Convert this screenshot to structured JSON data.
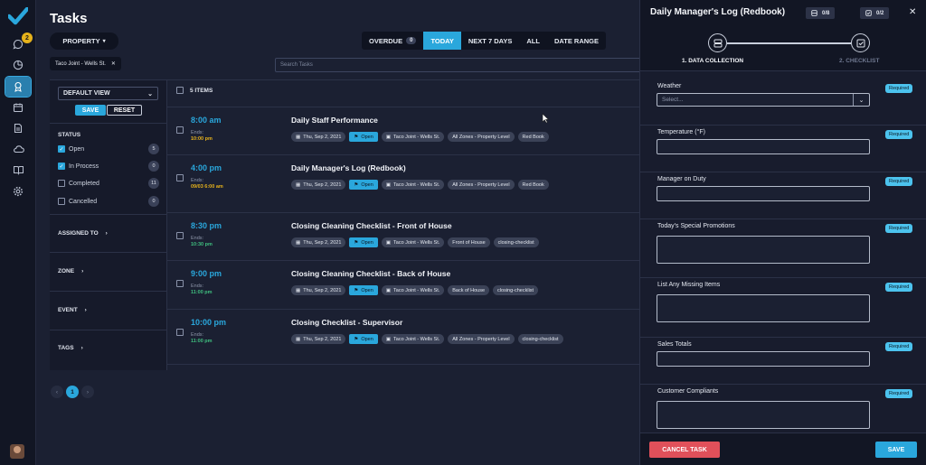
{
  "colors": {
    "accent": "#2aa7dc",
    "bg": "#1b2032",
    "danger": "#e0505a",
    "warning": "#e6b21b",
    "ends_green": "#3fbf7f"
  },
  "rail": {
    "badge": "2",
    "icons": [
      "check-logo-icon",
      "chat-icon",
      "clock-icon",
      "ribbon-icon",
      "calendar-icon",
      "document-icon",
      "cloud-icon",
      "book-icon",
      "gear-icon"
    ]
  },
  "header": {
    "title": "Tasks",
    "property_label": "PROPERTY",
    "filter_chip": "Taco Joint - Wells St.",
    "search_placeholder": "Search Tasks",
    "segments": [
      {
        "label": "OVERDUE",
        "count": "0",
        "active": false
      },
      {
        "label": "TODAY",
        "active": true
      },
      {
        "label": "NEXT 7 DAYS",
        "active": false
      },
      {
        "label": "ALL",
        "active": false
      },
      {
        "label": "DATE RANGE",
        "active": false
      }
    ]
  },
  "filters": {
    "view": "DEFAULT VIEW",
    "save": "SAVE",
    "reset": "RESET",
    "status_title": "STATUS",
    "statuses": [
      {
        "label": "Open",
        "count": "5",
        "checked": true
      },
      {
        "label": "In Process",
        "count": "0",
        "checked": true
      },
      {
        "label": "Completed",
        "count": "11",
        "checked": false
      },
      {
        "label": "Cancelled",
        "count": "0",
        "checked": false
      }
    ],
    "groups": [
      "ASSIGNED TO",
      "ZONE",
      "EVENT",
      "TAGS"
    ]
  },
  "list": {
    "items_label": "5 ITEMS",
    "ends_label": "Ends:",
    "tasks": [
      {
        "time": "8:00 am",
        "ends": "10:00 pm",
        "ends_color": "#e6b21b",
        "title": "Daily Staff Performance",
        "date": "Thu, Sep 2, 2021",
        "status": "Open",
        "location": "Taco Joint - Wells St.",
        "zone": "All Zones - Property Level",
        "tag": "Red Book"
      },
      {
        "time": "4:00 pm",
        "ends": "09/03 6:00 am",
        "ends_color": "#e6b21b",
        "title": "Daily Manager's Log (Redbook)",
        "date": "Thu, Sep 2, 2021",
        "status": "Open",
        "location": "Taco Joint - Wells St.",
        "zone": "All Zones - Property Level",
        "tag": "Red Book"
      },
      {
        "time": "8:30 pm",
        "ends": "10:30 pm",
        "ends_color": "#3fbf7f",
        "title": "Closing Cleaning Checklist - Front of House",
        "date": "Thu, Sep 2, 2021",
        "status": "Open",
        "location": "Taco Joint - Wells St.",
        "zone": "Front of House",
        "tag": "closing-checklist"
      },
      {
        "time": "9:00 pm",
        "ends": "11:00 pm",
        "ends_color": "#3fbf7f",
        "title": "Closing Cleaning Checklist - Back of House",
        "date": "Thu, Sep 2, 2021",
        "status": "Open",
        "location": "Taco Joint - Wells St.",
        "zone": "Back of House",
        "tag": "closing-checklist"
      },
      {
        "time": "10:00 pm",
        "ends": "11:00 pm",
        "ends_color": "#3fbf7f",
        "title": "Closing Checklist - Supervisor",
        "date": "Thu, Sep 2, 2021",
        "status": "Open",
        "location": "Taco Joint - Wells St.",
        "zone": "All Zones - Property Level",
        "tag": "closing-checklist"
      }
    ]
  },
  "pager": {
    "prev": "‹",
    "page": "1",
    "next": "›"
  },
  "drawer": {
    "title": "Daily Manager's Log (Redbook)",
    "count1": "0/8",
    "count2": "0/2",
    "close": "✕",
    "step1": "1. DATA COLLECTION",
    "step2": "2. CHECKLIST",
    "required": "Required",
    "fields": [
      {
        "label": "Weather",
        "type": "select",
        "placeholder": "Select..."
      },
      {
        "label": "Temperature (°F)",
        "type": "input"
      },
      {
        "label": "Manager on Duty",
        "type": "input"
      },
      {
        "label": "Today's Special Promotions",
        "type": "textarea"
      },
      {
        "label": "List Any Missing Items",
        "type": "textarea"
      },
      {
        "label": "Sales Totals",
        "type": "input"
      },
      {
        "label": "Customer Compliants",
        "type": "textarea"
      }
    ],
    "cancel": "CANCEL TASK",
    "save": "SAVE"
  }
}
